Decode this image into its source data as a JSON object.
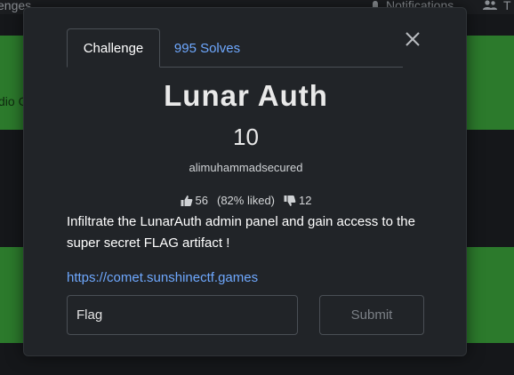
{
  "background": {
    "nav_left_text": "enges",
    "notifications_label": "Notifications",
    "team_label": "T",
    "band_text": "dio C",
    "band_color": "#2c7a2c"
  },
  "modal": {
    "tabs": [
      {
        "label": "Challenge",
        "active": true
      },
      {
        "label": "995 Solves",
        "active": false
      }
    ],
    "title": "Lunar Auth",
    "points": "10",
    "author": "alimuhammadsecured",
    "votes": {
      "likes": "56",
      "liked_percent": "(82% liked)",
      "dislikes": "12"
    },
    "description": "Infiltrate the LunarAuth admin panel and gain access to the super secret FLAG artifact !",
    "link": "https://comet.sunshinectf.games",
    "flag_placeholder": "Flag",
    "submit_label": "Submit"
  },
  "colors": {
    "modal_bg": "#212428",
    "link": "#6ea8fe",
    "border": "#4a4f55"
  }
}
